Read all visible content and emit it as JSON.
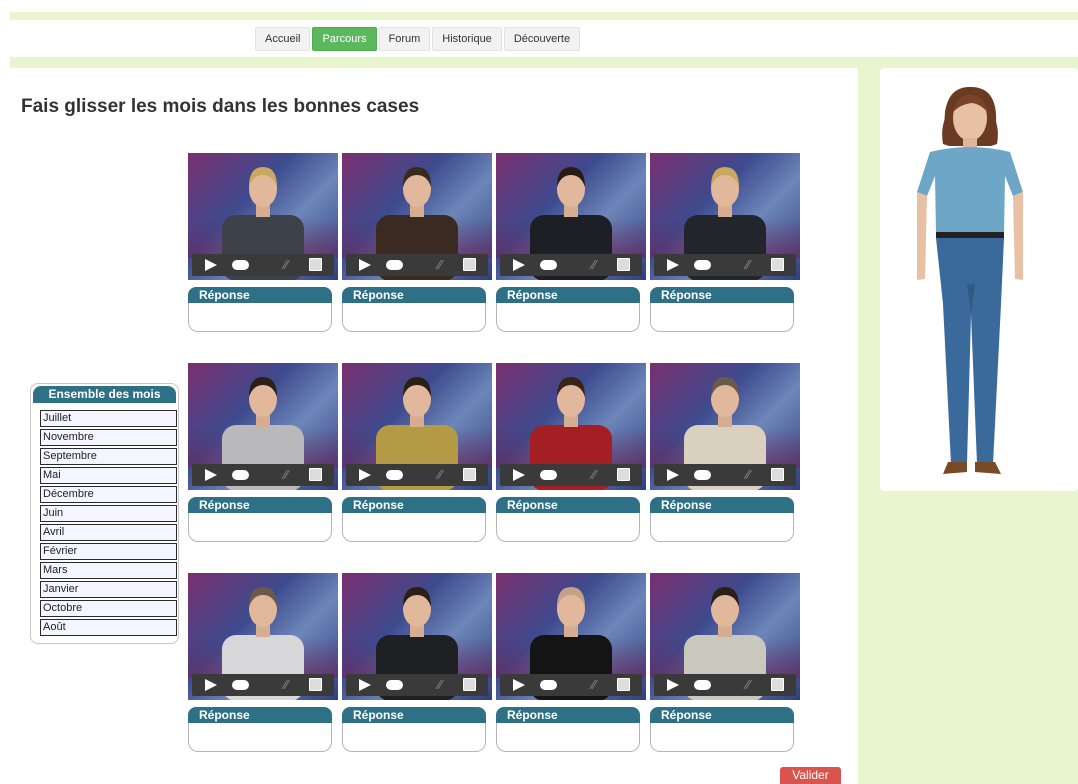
{
  "nav": {
    "items": [
      {
        "label": "Accueil",
        "active": false
      },
      {
        "label": "Parcours",
        "active": true
      },
      {
        "label": "Forum",
        "active": false
      },
      {
        "label": "Historique",
        "active": false
      },
      {
        "label": "Découverte",
        "active": false
      }
    ]
  },
  "page": {
    "title": "Fais glisser les mois dans les bonnes cases",
    "answer_label": "Réponse",
    "submit_label": "Valider"
  },
  "months_panel": {
    "title": "Ensemble des mois",
    "items": [
      "Juillet",
      "Novembre",
      "Septembre",
      "Mai",
      "Décembre",
      "Juin",
      "Avril",
      "Février",
      "Mars",
      "Janvier",
      "Octobre",
      "Août"
    ]
  },
  "videos": [
    {
      "hair": "#c8a861",
      "shirt": "#3d4149"
    },
    {
      "hair": "#3a2a1e",
      "shirt": "#3a2a22"
    },
    {
      "hair": "#2a1a14",
      "shirt": "#1e1e26"
    },
    {
      "hair": "#c8a861",
      "shirt": "#22252c"
    },
    {
      "hair": "#2a2018",
      "shirt": "#b9b9bb"
    },
    {
      "hair": "#2a2018",
      "shirt": "#b59a45"
    },
    {
      "hair": "#3a2418",
      "shirt": "#a31f24"
    },
    {
      "hair": "#6b5a4a",
      "shirt": "#d9d0c0"
    },
    {
      "hair": "#6b5a4a",
      "shirt": "#d7d7da"
    },
    {
      "hair": "#2a2018",
      "shirt": "#1f2024"
    },
    {
      "hair": "#c6a18a",
      "shirt": "#141414"
    },
    {
      "hair": "#2a2018",
      "shirt": "#c9c8bf"
    }
  ],
  "colors": {
    "accent": "#2e7085",
    "nav_active": "#5cb85c",
    "submit": "#d9534f",
    "background": "#e9f5cf"
  }
}
